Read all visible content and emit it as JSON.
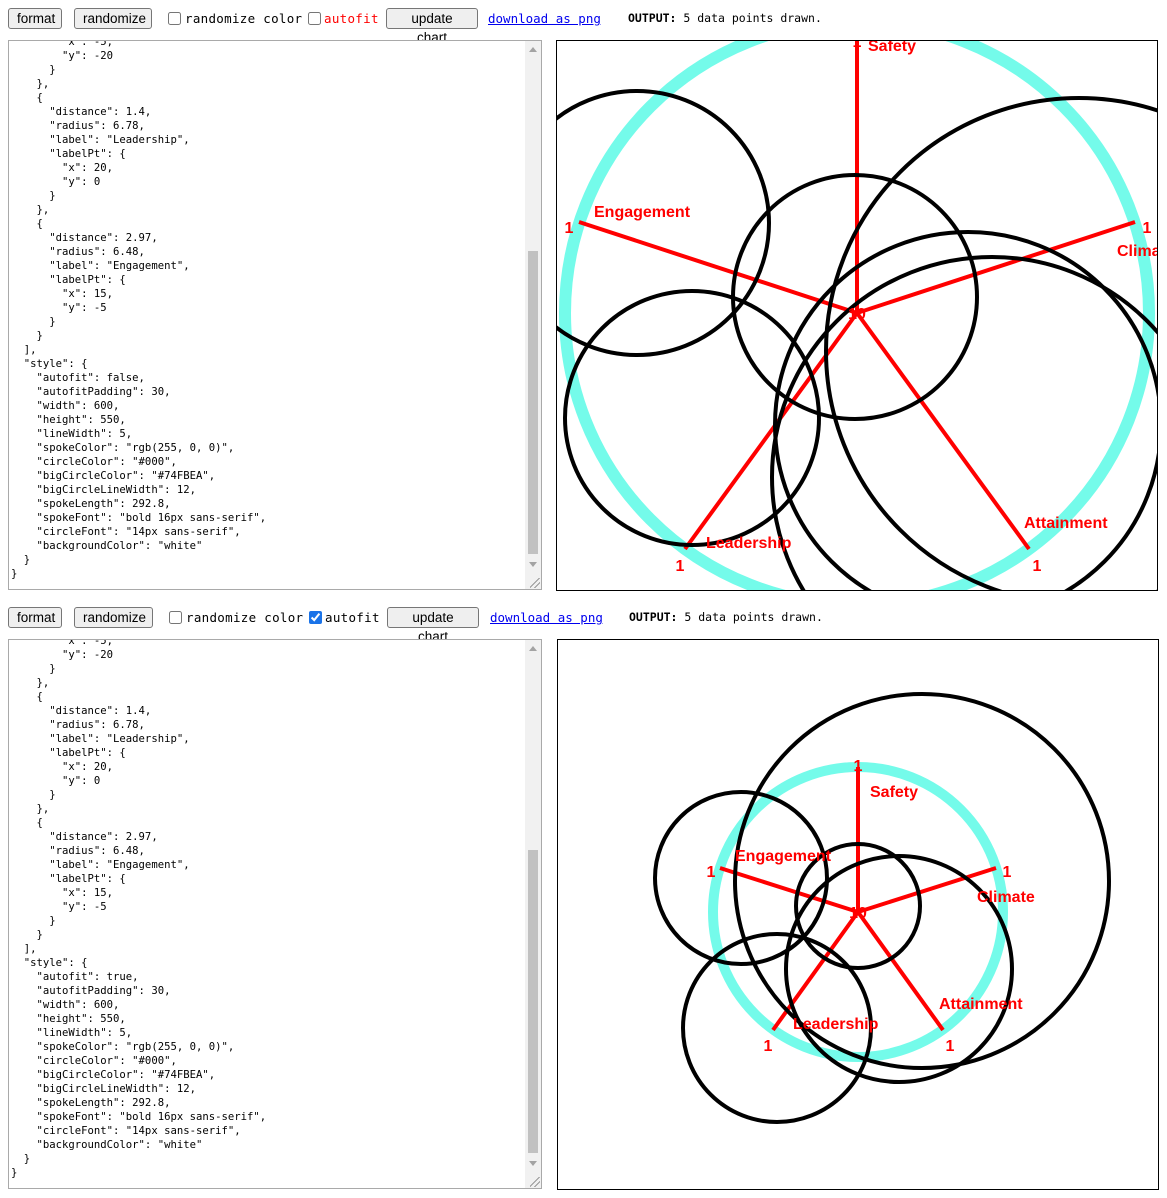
{
  "panels": [
    {
      "toolbar": {
        "format_label": "format",
        "randomize_label": "randomize",
        "randomize_color_label": "randomize color",
        "randomize_color_checked": false,
        "autofit_label": "autofit",
        "autofit_checked": false,
        "update_label": "update chart",
        "download_label": "download as png",
        "output_label": "OUTPUT:",
        "output_text": "5 data points drawn."
      },
      "editor_text": "        \"x\": -5,\n        \"y\": -20\n      }\n    },\n    {\n      \"distance\": 1.4,\n      \"radius\": 6.78,\n      \"label\": \"Leadership\",\n      \"labelPt\": {\n        \"x\": 20,\n        \"y\": 0\n      }\n    },\n    {\n      \"distance\": 2.97,\n      \"radius\": 6.48,\n      \"label\": \"Engagement\",\n      \"labelPt\": {\n        \"x\": 15,\n        \"y\": -5\n      }\n    }\n  ],\n  \"style\": {\n    \"autofit\": false,\n    \"autofitPadding\": 30,\n    \"width\": 600,\n    \"height\": 550,\n    \"lineWidth\": 5,\n    \"spokeColor\": \"rgb(255, 0, 0)\",\n    \"circleColor\": \"#000\",\n    \"bigCircleColor\": \"#74FBEA\",\n    \"bigCircleLineWidth\": 12,\n    \"spokeLength\": 292.8,\n    \"spokeFont\": \"bold 16px sans-serif\",\n    \"circleFont\": \"14px sans-serif\",\n    \"backgroundColor\": \"white\"\n  }\n}",
      "chart": {
        "center_label": "10",
        "spokes": [
          {
            "label": "Safety",
            "end_label": "1"
          },
          {
            "label": "Climate",
            "end_label": "1"
          },
          {
            "label": "Attainment",
            "end_label": "1"
          },
          {
            "label": "Leadership",
            "end_label": "1"
          },
          {
            "label": "Engagement",
            "end_label": "1"
          }
        ]
      }
    },
    {
      "toolbar": {
        "format_label": "format",
        "randomize_label": "randomize",
        "randomize_color_label": "randomize color",
        "randomize_color_checked": false,
        "autofit_label": "autofit",
        "autofit_checked": true,
        "update_label": "update chart",
        "download_label": "download as png",
        "output_label": "OUTPUT:",
        "output_text": "5 data points drawn."
      },
      "editor_text": "        \"x\": -5,\n        \"y\": -20\n      }\n    },\n    {\n      \"distance\": 1.4,\n      \"radius\": 6.78,\n      \"label\": \"Leadership\",\n      \"labelPt\": {\n        \"x\": 20,\n        \"y\": 0\n      }\n    },\n    {\n      \"distance\": 2.97,\n      \"radius\": 6.48,\n      \"label\": \"Engagement\",\n      \"labelPt\": {\n        \"x\": 15,\n        \"y\": -5\n      }\n    }\n  ],\n  \"style\": {\n    \"autofit\": true,\n    \"autofitPadding\": 30,\n    \"width\": 600,\n    \"height\": 550,\n    \"lineWidth\": 5,\n    \"spokeColor\": \"rgb(255, 0, 0)\",\n    \"circleColor\": \"#000\",\n    \"bigCircleColor\": \"#74FBEA\",\n    \"bigCircleLineWidth\": 12,\n    \"spokeLength\": 292.8,\n    \"spokeFont\": \"bold 16px sans-serif\",\n    \"circleFont\": \"14px sans-serif\",\n    \"backgroundColor\": \"white\"\n  }\n}",
      "chart": {
        "center_label": "10",
        "spokes": [
          {
            "label": "Safety",
            "end_label": "1"
          },
          {
            "label": "Climate",
            "end_label": "1"
          },
          {
            "label": "Attainment",
            "end_label": "1"
          },
          {
            "label": "Leadership",
            "end_label": "1"
          },
          {
            "label": "Engagement",
            "end_label": "1"
          }
        ]
      }
    }
  ],
  "colors": {
    "spoke": "#ff0000",
    "circle": "#000000",
    "big_circle": "#74FBEA",
    "background": "#ffffff",
    "link": "#0000ee",
    "autofit_unchecked_label": "#ff0000"
  }
}
